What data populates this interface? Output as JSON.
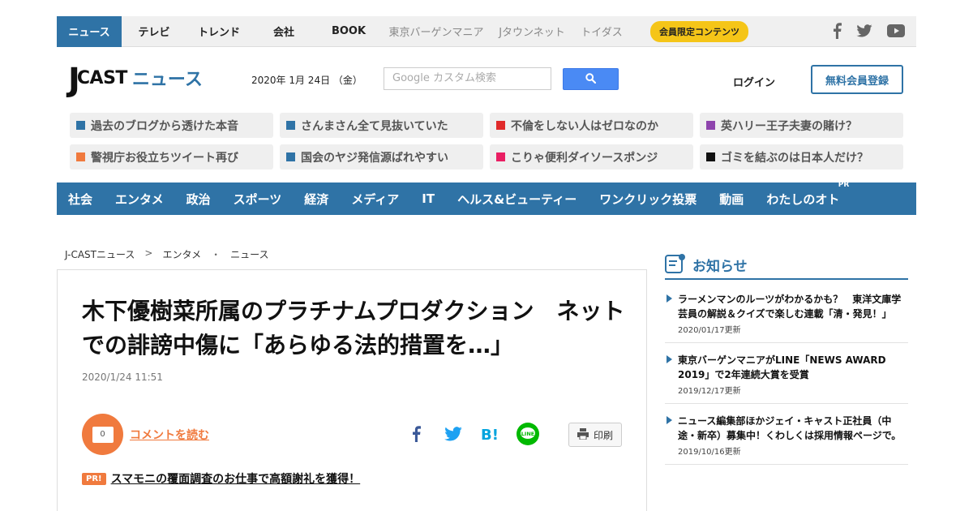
{
  "topbar": {
    "items": [
      {
        "label": "ニュース",
        "style": "active"
      },
      {
        "label": "テレビ",
        "style": "normal"
      },
      {
        "label": "トレンド",
        "style": "normal"
      },
      {
        "label": "会社",
        "style": "normal"
      },
      {
        "label": "BOOK",
        "style": "normal"
      },
      {
        "label": "東京バーゲンマニア",
        "style": "muted"
      },
      {
        "label": "Jタウンネット",
        "style": "muted"
      },
      {
        "label": "トイダス",
        "style": "muted"
      }
    ],
    "member_badge": "会員限定コンテンツ",
    "socials": [
      "facebook-icon",
      "twitter-icon",
      "youtube-icon"
    ]
  },
  "header": {
    "logo_j": "J",
    "logo_cast": "CAST",
    "logo_news": "ニュース",
    "date": "2020年 1月 24日 （金）",
    "search_placeholder": "Google カスタム検索",
    "login": "ログイン",
    "register": "無料会員登録"
  },
  "topics": [
    {
      "label": "過去のブログから透けた本音",
      "color": "#2f73a6"
    },
    {
      "label": "さんまさん全て見抜いていた",
      "color": "#2f73a6"
    },
    {
      "label": "不倫をしない人はゼロなのか",
      "color": "#e02a2a"
    },
    {
      "label": "英ハリー王子夫妻の賭け？",
      "color": "#8e44ad"
    },
    {
      "label": "警視庁お役立ちツイート再び",
      "color": "#f07a3e"
    },
    {
      "label": "国会のヤジ発信源ばれやすい",
      "color": "#2f73a6"
    },
    {
      "label": "こりゃ便利ダイソースポンジ",
      "color": "#e91e63"
    },
    {
      "label": "ゴミを結ぶのは日本人だけ？",
      "color": "#111111"
    }
  ],
  "categories": [
    "社会",
    "エンタメ",
    "政治",
    "スポーツ",
    "経済",
    "メディア",
    "IT",
    "ヘルス&ビューティー",
    "ワンクリック投票",
    "動画",
    "わたしのオト"
  ],
  "category_pr": "PR",
  "breadcrumb": {
    "home": "J-CASTニュース",
    "sep1": ">",
    "section": "エンタメ",
    "sep2": "・",
    "sub": "ニュース"
  },
  "article": {
    "title": "木下優樹菜所属のプラチナムプロダクション　ネットでの誹謗中傷に「あらゆる法的措置を…」",
    "timestamp": "2020/1/24 11:51",
    "comment_count": "0",
    "comment_link": "コメントを読む",
    "share_icons": [
      "facebook-share-icon",
      "twitter-share-icon",
      "hatena-bookmark-icon",
      "line-share-icon"
    ],
    "print_label": "印刷",
    "pr_badge": "PR!",
    "pr_link": "スマモニの覆面調査のお仕事で高額謝礼を獲得！"
  },
  "sidebar": {
    "notice_title": "お知らせ",
    "notices": [
      {
        "text": "ラーメンマンのルーツがわかるかも？　東洋文庫学芸員の解説＆クイズで楽しむ連載「清・発見！」",
        "date": "2020/01/17更新"
      },
      {
        "text": "東京バーゲンマニアがLINE「NEWS AWARD 2019」で2年連続大賞を受賞",
        "date": "2019/12/17更新"
      },
      {
        "text": "ニュース編集部ほかジェイ・キャスト正社員（中途・新卒）募集中！くわしくは採用情報ページで。",
        "date": "2019/10/16更新"
      }
    ]
  },
  "colors": {
    "brand_blue": "#2f73a6",
    "accent_orange": "#f07a3e",
    "badge_yellow": "#f5c518",
    "search_blue": "#4a8af4"
  }
}
